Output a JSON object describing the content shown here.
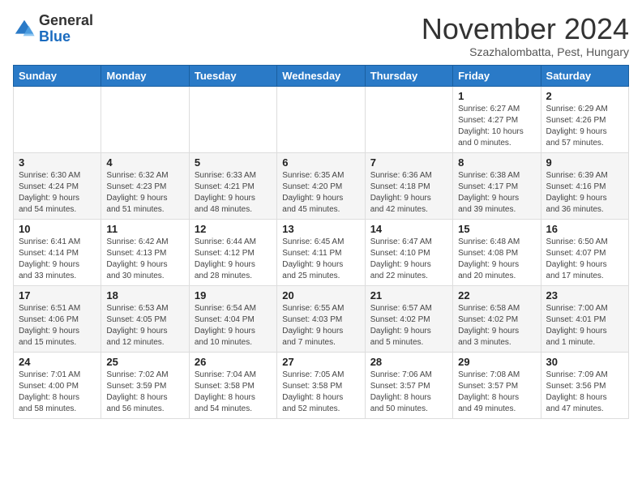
{
  "logo": {
    "general": "General",
    "blue": "Blue"
  },
  "title": {
    "month": "November 2024",
    "location": "Szazhalombatta, Pest, Hungary"
  },
  "weekdays": [
    "Sunday",
    "Monday",
    "Tuesday",
    "Wednesday",
    "Thursday",
    "Friday",
    "Saturday"
  ],
  "weeks": [
    [
      {
        "day": "",
        "info": ""
      },
      {
        "day": "",
        "info": ""
      },
      {
        "day": "",
        "info": ""
      },
      {
        "day": "",
        "info": ""
      },
      {
        "day": "",
        "info": ""
      },
      {
        "day": "1",
        "info": "Sunrise: 6:27 AM\nSunset: 4:27 PM\nDaylight: 10 hours\nand 0 minutes."
      },
      {
        "day": "2",
        "info": "Sunrise: 6:29 AM\nSunset: 4:26 PM\nDaylight: 9 hours\nand 57 minutes."
      }
    ],
    [
      {
        "day": "3",
        "info": "Sunrise: 6:30 AM\nSunset: 4:24 PM\nDaylight: 9 hours\nand 54 minutes."
      },
      {
        "day": "4",
        "info": "Sunrise: 6:32 AM\nSunset: 4:23 PM\nDaylight: 9 hours\nand 51 minutes."
      },
      {
        "day": "5",
        "info": "Sunrise: 6:33 AM\nSunset: 4:21 PM\nDaylight: 9 hours\nand 48 minutes."
      },
      {
        "day": "6",
        "info": "Sunrise: 6:35 AM\nSunset: 4:20 PM\nDaylight: 9 hours\nand 45 minutes."
      },
      {
        "day": "7",
        "info": "Sunrise: 6:36 AM\nSunset: 4:18 PM\nDaylight: 9 hours\nand 42 minutes."
      },
      {
        "day": "8",
        "info": "Sunrise: 6:38 AM\nSunset: 4:17 PM\nDaylight: 9 hours\nand 39 minutes."
      },
      {
        "day": "9",
        "info": "Sunrise: 6:39 AM\nSunset: 4:16 PM\nDaylight: 9 hours\nand 36 minutes."
      }
    ],
    [
      {
        "day": "10",
        "info": "Sunrise: 6:41 AM\nSunset: 4:14 PM\nDaylight: 9 hours\nand 33 minutes."
      },
      {
        "day": "11",
        "info": "Sunrise: 6:42 AM\nSunset: 4:13 PM\nDaylight: 9 hours\nand 30 minutes."
      },
      {
        "day": "12",
        "info": "Sunrise: 6:44 AM\nSunset: 4:12 PM\nDaylight: 9 hours\nand 28 minutes."
      },
      {
        "day": "13",
        "info": "Sunrise: 6:45 AM\nSunset: 4:11 PM\nDaylight: 9 hours\nand 25 minutes."
      },
      {
        "day": "14",
        "info": "Sunrise: 6:47 AM\nSunset: 4:10 PM\nDaylight: 9 hours\nand 22 minutes."
      },
      {
        "day": "15",
        "info": "Sunrise: 6:48 AM\nSunset: 4:08 PM\nDaylight: 9 hours\nand 20 minutes."
      },
      {
        "day": "16",
        "info": "Sunrise: 6:50 AM\nSunset: 4:07 PM\nDaylight: 9 hours\nand 17 minutes."
      }
    ],
    [
      {
        "day": "17",
        "info": "Sunrise: 6:51 AM\nSunset: 4:06 PM\nDaylight: 9 hours\nand 15 minutes."
      },
      {
        "day": "18",
        "info": "Sunrise: 6:53 AM\nSunset: 4:05 PM\nDaylight: 9 hours\nand 12 minutes."
      },
      {
        "day": "19",
        "info": "Sunrise: 6:54 AM\nSunset: 4:04 PM\nDaylight: 9 hours\nand 10 minutes."
      },
      {
        "day": "20",
        "info": "Sunrise: 6:55 AM\nSunset: 4:03 PM\nDaylight: 9 hours\nand 7 minutes."
      },
      {
        "day": "21",
        "info": "Sunrise: 6:57 AM\nSunset: 4:02 PM\nDaylight: 9 hours\nand 5 minutes."
      },
      {
        "day": "22",
        "info": "Sunrise: 6:58 AM\nSunset: 4:02 PM\nDaylight: 9 hours\nand 3 minutes."
      },
      {
        "day": "23",
        "info": "Sunrise: 7:00 AM\nSunset: 4:01 PM\nDaylight: 9 hours\nand 1 minute."
      }
    ],
    [
      {
        "day": "24",
        "info": "Sunrise: 7:01 AM\nSunset: 4:00 PM\nDaylight: 8 hours\nand 58 minutes."
      },
      {
        "day": "25",
        "info": "Sunrise: 7:02 AM\nSunset: 3:59 PM\nDaylight: 8 hours\nand 56 minutes."
      },
      {
        "day": "26",
        "info": "Sunrise: 7:04 AM\nSunset: 3:58 PM\nDaylight: 8 hours\nand 54 minutes."
      },
      {
        "day": "27",
        "info": "Sunrise: 7:05 AM\nSunset: 3:58 PM\nDaylight: 8 hours\nand 52 minutes."
      },
      {
        "day": "28",
        "info": "Sunrise: 7:06 AM\nSunset: 3:57 PM\nDaylight: 8 hours\nand 50 minutes."
      },
      {
        "day": "29",
        "info": "Sunrise: 7:08 AM\nSunset: 3:57 PM\nDaylight: 8 hours\nand 49 minutes."
      },
      {
        "day": "30",
        "info": "Sunrise: 7:09 AM\nSunset: 3:56 PM\nDaylight: 8 hours\nand 47 minutes."
      }
    ]
  ]
}
